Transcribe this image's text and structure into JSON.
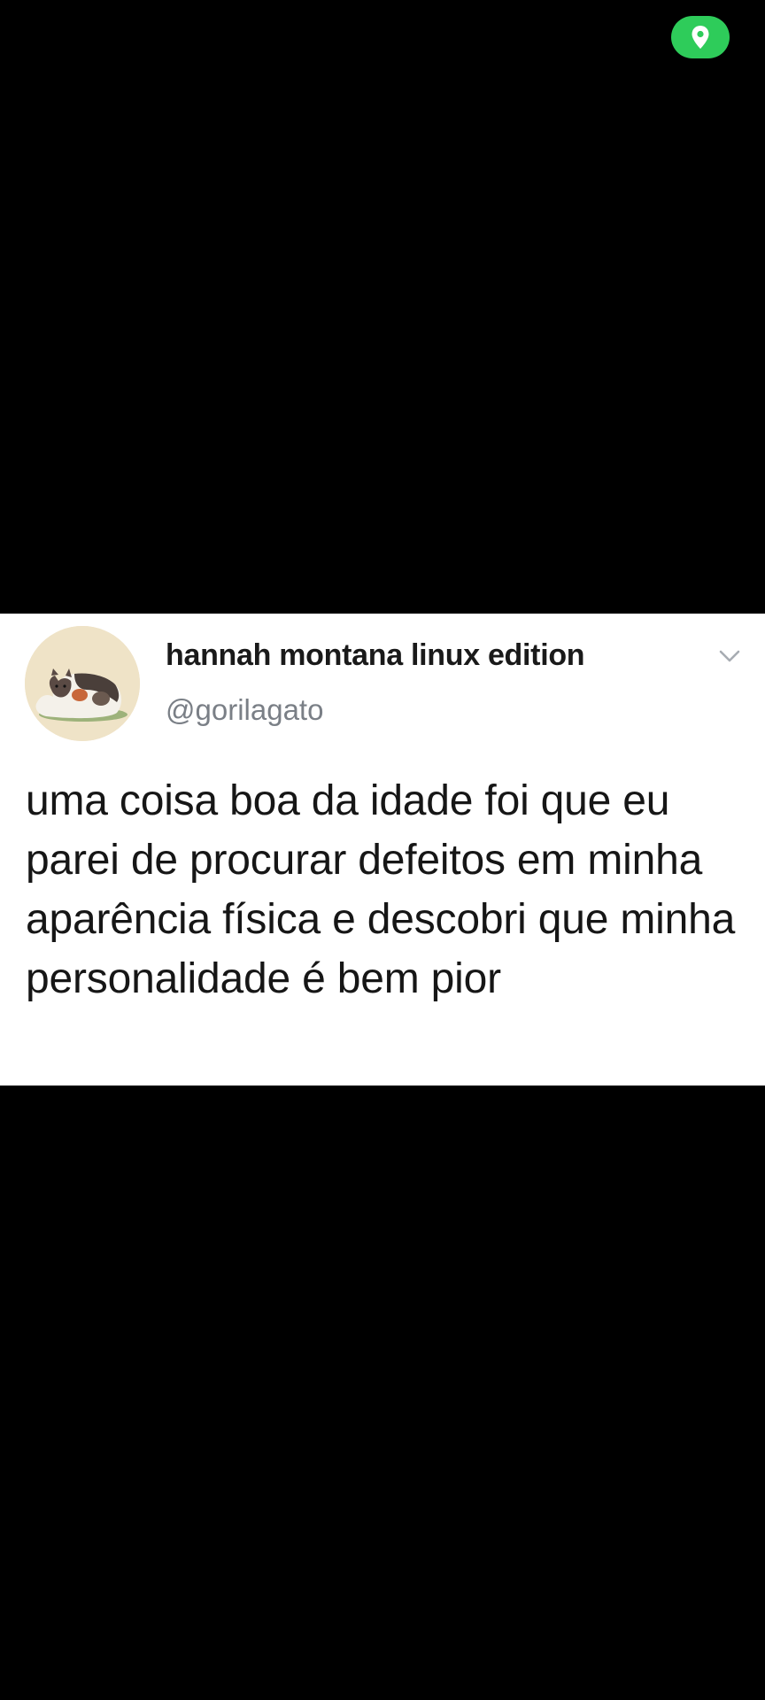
{
  "status": {
    "location_icon": "map-pin-icon",
    "pill_color": "#2ecc5a"
  },
  "tweet": {
    "display_name": "hannah montana linux edition",
    "handle": "@gorilagato",
    "text": "uma coisa boa da idade foi que eu parei de procurar defeitos em minha aparência física e descobri que minha personalidade é bem pior",
    "avatar_icon": "cat-avatar",
    "menu_icon": "chevron-down-icon"
  },
  "colors": {
    "background": "#000000",
    "card": "#ffffff",
    "name": "#1a1a1a",
    "handle": "#7a7f86",
    "text": "#161616"
  }
}
